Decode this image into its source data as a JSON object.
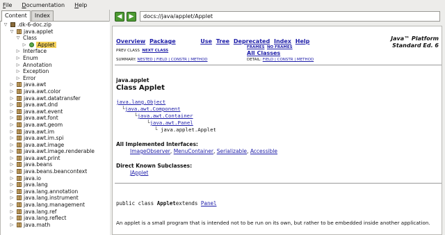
{
  "menu": [
    "File",
    "Documentation",
    "Help"
  ],
  "tabs": [
    "Content",
    "Index"
  ],
  "tree": [
    {
      "label": ".dk-6-doc.zip",
      "indent": 0,
      "twisty": "▽",
      "icon": "jar"
    },
    {
      "label": "java.applet",
      "indent": 1,
      "twisty": "▽",
      "icon": "pkg"
    },
    {
      "label": "Class",
      "indent": 2,
      "twisty": "▽",
      "icon": ""
    },
    {
      "label": "Applet",
      "indent": 3,
      "twisty": "▷",
      "icon": "cls",
      "selected": true
    },
    {
      "label": "Interface",
      "indent": 2,
      "twisty": "▷",
      "icon": ""
    },
    {
      "label": "Enum",
      "indent": 2,
      "twisty": "▷",
      "icon": ""
    },
    {
      "label": "Annotation",
      "indent": 2,
      "twisty": "▷",
      "icon": ""
    },
    {
      "label": "Exception",
      "indent": 2,
      "twisty": "▷",
      "icon": ""
    },
    {
      "label": "Error",
      "indent": 2,
      "twisty": "▷",
      "icon": ""
    },
    {
      "label": "java.awt",
      "indent": 1,
      "twisty": "▷",
      "icon": "pkg"
    },
    {
      "label": "java.awt.color",
      "indent": 1,
      "twisty": "▷",
      "icon": "pkg"
    },
    {
      "label": "java.awt.datatransfer",
      "indent": 1,
      "twisty": "▷",
      "icon": "pkg"
    },
    {
      "label": "java.awt.dnd",
      "indent": 1,
      "twisty": "▷",
      "icon": "pkg"
    },
    {
      "label": "java.awt.event",
      "indent": 1,
      "twisty": "▷",
      "icon": "pkg"
    },
    {
      "label": "java.awt.font",
      "indent": 1,
      "twisty": "▷",
      "icon": "pkg"
    },
    {
      "label": "java.awt.geom",
      "indent": 1,
      "twisty": "▷",
      "icon": "pkg"
    },
    {
      "label": "java.awt.im",
      "indent": 1,
      "twisty": "▷",
      "icon": "pkg"
    },
    {
      "label": "java.awt.im.spi",
      "indent": 1,
      "twisty": "▷",
      "icon": "pkg"
    },
    {
      "label": "java.awt.image",
      "indent": 1,
      "twisty": "▷",
      "icon": "pkg"
    },
    {
      "label": "java.awt.image.renderable",
      "indent": 1,
      "twisty": "▷",
      "icon": "pkg"
    },
    {
      "label": "java.awt.print",
      "indent": 1,
      "twisty": "▷",
      "icon": "pkg"
    },
    {
      "label": "java.beans",
      "indent": 1,
      "twisty": "▷",
      "icon": "pkg"
    },
    {
      "label": "java.beans.beancontext",
      "indent": 1,
      "twisty": "▷",
      "icon": "pkg"
    },
    {
      "label": "java.io",
      "indent": 1,
      "twisty": "▷",
      "icon": "pkg"
    },
    {
      "label": "java.lang",
      "indent": 1,
      "twisty": "▷",
      "icon": "pkg"
    },
    {
      "label": "java.lang.annotation",
      "indent": 1,
      "twisty": "▷",
      "icon": "pkg"
    },
    {
      "label": "java.lang.instrument",
      "indent": 1,
      "twisty": "▷",
      "icon": "pkg"
    },
    {
      "label": "java.lang.management",
      "indent": 1,
      "twisty": "▷",
      "icon": "pkg"
    },
    {
      "label": "java.lang.ref",
      "indent": 1,
      "twisty": "▷",
      "icon": "pkg"
    },
    {
      "label": "java.lang.reflect",
      "indent": 1,
      "twisty": "▷",
      "icon": "pkg"
    },
    {
      "label": "java.math",
      "indent": 1,
      "twisty": "▷",
      "icon": "pkg"
    }
  ],
  "nav": {
    "back": "◀",
    "forward": "▶",
    "url": "docs://java/applet/Applet"
  },
  "doc": {
    "topnav": [
      "Overview",
      "Package",
      "Use",
      "Tree",
      "Deprecated",
      "Index",
      "Help"
    ],
    "brand_line1": "Java™ Platform",
    "brand_line2": "Standard Ed. 6",
    "prev_class": "PREV CLASS",
    "next_class": "NEXT CLASS",
    "frames": "FRAMES",
    "no_frames": "NO FRAMES",
    "all_classes": "All Classes",
    "summary_label": "SUMMARY:",
    "summary_links": "NESTED | FIELD | CONSTR | METHOD",
    "detail_label": "DETAIL:",
    "detail_links": "FIELD | CONSTR | METHOD",
    "package_name": "java.applet",
    "class_title": "Class Applet",
    "hierarchy": [
      "java.lang.Object",
      "java.awt.Component",
      "java.awt.Container",
      "java.awt.Panel",
      "java.applet.Applet"
    ],
    "all_impl_label": "All Implemented Interfaces:",
    "interfaces": [
      "ImageObserver",
      "MenuContainer",
      "Serializable",
      "Accessible"
    ],
    "direct_sub_label": "Direct Known Subclasses:",
    "subclasses": [
      "JApplet"
    ],
    "decl_prefix": "public class ",
    "decl_name": "Applet",
    "decl_extends": "extends ",
    "decl_super": "Panel",
    "description": "An applet is a small program that is intended not to be run on its own, but rather to be embedded inside another application."
  }
}
